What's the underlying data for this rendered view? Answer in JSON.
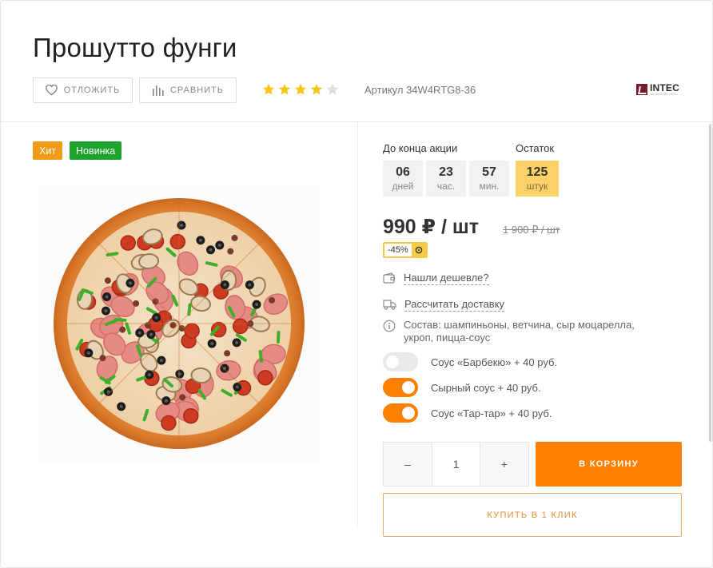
{
  "product": {
    "title": "Прошутто фунги",
    "sku": "Артикул 34W4RTG8-36",
    "rating": 4,
    "rating_max": 5,
    "brand": {
      "name": "INTEC",
      "sub": "ТЕХНОЛОГИИ РОСТА"
    }
  },
  "toolbar": {
    "defer_label": "ОТЛОЖИТЬ",
    "compare_label": "СРАВНИТЬ"
  },
  "badges": {
    "hit": "Хит",
    "new": "Новинка"
  },
  "countdown": {
    "label": "До конца акции",
    "days": {
      "value": "06",
      "unit": "дней"
    },
    "hours": {
      "value": "23",
      "unit": "час."
    },
    "minutes": {
      "value": "57",
      "unit": "мин."
    }
  },
  "stock": {
    "label": "Остаток",
    "value": "125",
    "unit": "штук"
  },
  "price": {
    "current": "990 ₽ / шт",
    "old": "1 900 ₽ / шт",
    "discount": "-45%"
  },
  "links": {
    "cheaper": "Нашли дешевле?",
    "delivery": "Рассчитать доставку"
  },
  "composition": "Состав: шампиньоны, ветчина, сыр моцарелла, укроп, пицца-соус",
  "sauces": [
    {
      "label": "Соус «Барбекю» + 40 руб.",
      "enabled": false
    },
    {
      "label": "Сырный соус + 40 руб.",
      "enabled": true
    },
    {
      "label": "Соус «Тар-тар» + 40 руб.",
      "enabled": true
    }
  ],
  "quantity": {
    "minus": "–",
    "value": "1",
    "plus": "+"
  },
  "actions": {
    "cart": "В КОРЗИНУ",
    "one_click": "КУПИТЬ В 1 КЛИК"
  },
  "colors": {
    "accent": "#ff7f00",
    "stock_bg": "#fbd268",
    "hit_badge": "#f39a19",
    "new_badge": "#1fa32f",
    "star": "#f5c518"
  }
}
